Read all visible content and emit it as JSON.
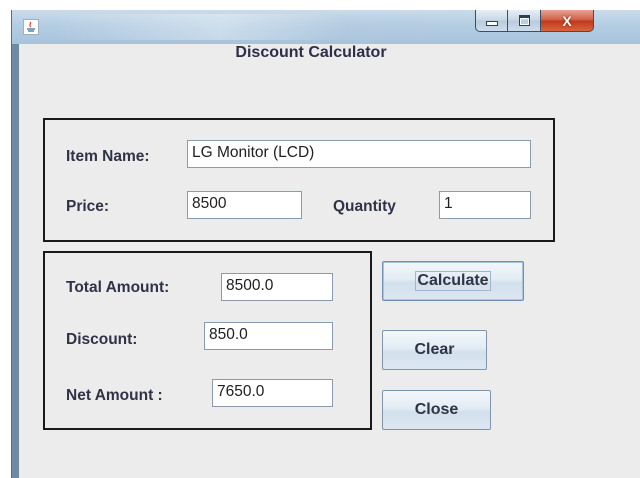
{
  "window": {
    "title": "",
    "controls": {
      "minimize_icon": "minimize-icon",
      "maximize_icon": "maximize-icon",
      "close_icon": "close-icon",
      "close_label": "X"
    }
  },
  "form": {
    "heading": "Discount Calculator",
    "item_panel": {
      "item_name_label": "Item Name:",
      "item_name_value": "LG Monitor (LCD)",
      "price_label": "Price:",
      "price_value": "8500",
      "quantity_label": "Quantity",
      "quantity_value": "1"
    },
    "result_panel": {
      "total_label": "Total Amount:",
      "total_value": "8500.0",
      "discount_label": "Discount:",
      "discount_value": "850.0",
      "net_label": "Net Amount :",
      "net_value": "7650.0"
    },
    "buttons": {
      "calculate": "Calculate",
      "clear": "Clear",
      "close": "Close"
    }
  },
  "colors": {
    "titlebar": "#b4cde2",
    "client_bg": "#ececec",
    "close_button": "#c0371c",
    "label_text": "#2e3346"
  }
}
